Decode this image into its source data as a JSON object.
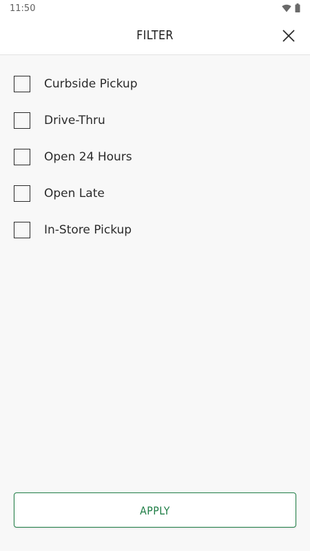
{
  "status_bar": {
    "time": "11:50",
    "icons": [
      "wifi-icon",
      "battery-icon"
    ]
  },
  "header": {
    "title": "FILTER",
    "close_icon": "close-icon"
  },
  "filters": [
    {
      "label": "Curbside Pickup",
      "checked": false
    },
    {
      "label": "Drive-Thru",
      "checked": false
    },
    {
      "label": "Open 24 Hours",
      "checked": false
    },
    {
      "label": "Open Late",
      "checked": false
    },
    {
      "label": "In-Store Pickup",
      "checked": false
    }
  ],
  "footer": {
    "apply_label": "APPLY"
  },
  "colors": {
    "accent": "#1e7d45",
    "background": "#f8f8f8",
    "text": "#2b2b2b"
  }
}
